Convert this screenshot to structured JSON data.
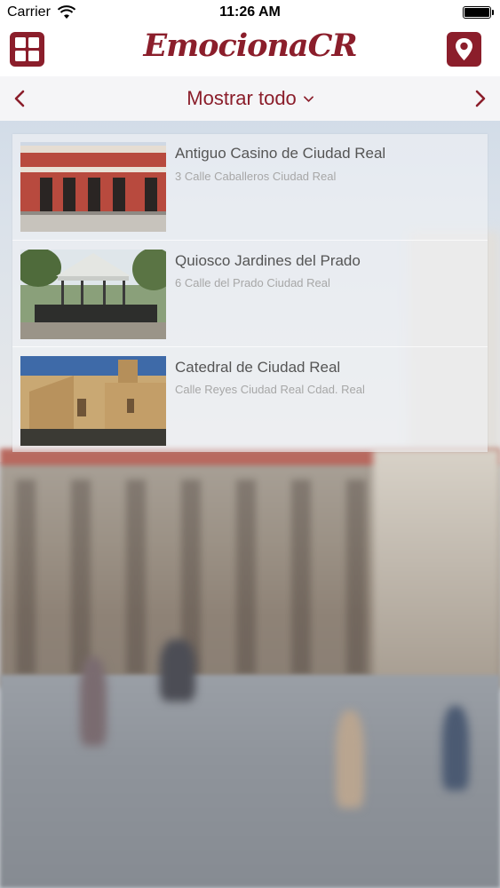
{
  "status_bar": {
    "carrier": "Carrier",
    "time": "11:26 AM",
    "battery_level": 1.0
  },
  "nav": {
    "left_icon": "grid-icon",
    "title": "EmocionaCR",
    "right_icon": "location-pin-icon"
  },
  "filter": {
    "prev_arrow": "‹",
    "label": "Mostrar todo",
    "dropdown_glyph": "⌄",
    "next_arrow": "›"
  },
  "places": [
    {
      "name": "Antiguo Casino de Ciudad Real",
      "address": "3 Calle Caballeros Ciudad Real"
    },
    {
      "name": "Quiosco Jardines del Prado",
      "address": "6 Calle del Prado Ciudad Real"
    },
    {
      "name": "Catedral de Ciudad Real",
      "address": "Calle Reyes Ciudad Real Cdad. Real"
    }
  ],
  "colors": {
    "brand": "#8b1e2b",
    "text_secondary": "#a7a7a7"
  }
}
